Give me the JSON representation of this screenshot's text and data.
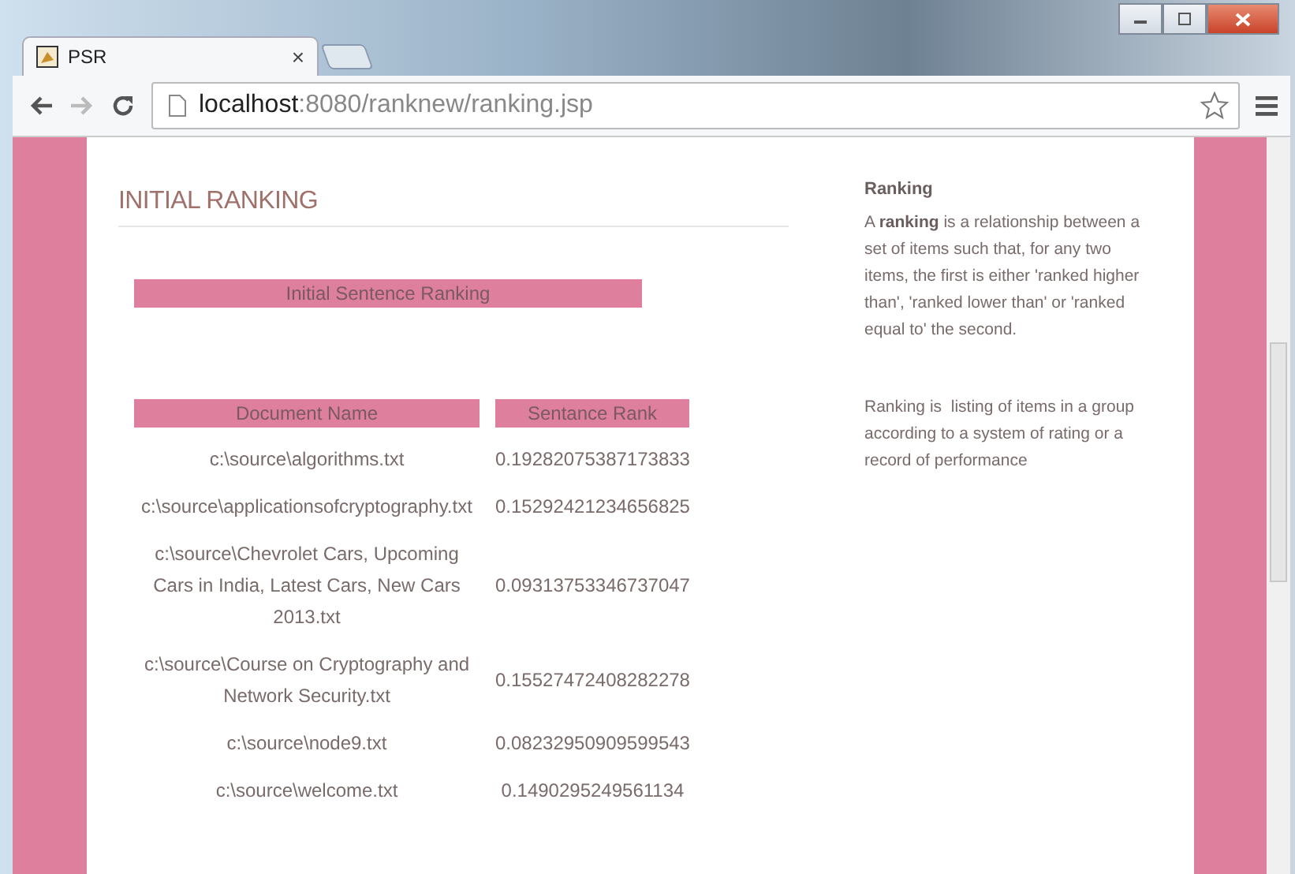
{
  "browser": {
    "tab_title": "PSR",
    "tab_close": "×",
    "url_host": "localhost",
    "url_path": ":8080/ranknew/ranking.jsp"
  },
  "page": {
    "heading": "INITIAL RANKING",
    "table_caption": "Initial Sentence Ranking",
    "columns": [
      "Document Name",
      "Sentance Rank"
    ],
    "rows": [
      {
        "document": "c:\\source\\algorithms.txt",
        "rank": "0.19282075387173833"
      },
      {
        "document": "c:\\source\\applicationsofcryptography.txt",
        "rank": "0.15292421234656825"
      },
      {
        "document": "c:\\source\\Chevrolet Cars, Upcoming Cars in India, Latest Cars, New Cars 2013.txt",
        "rank": "0.09313753346737047"
      },
      {
        "document": "c:\\source\\Course on Cryptography and Network Security.txt",
        "rank": "0.15527472408282278"
      },
      {
        "document": "c:\\source\\node9.txt",
        "rank": "0.08232950909599543"
      },
      {
        "document": "c:\\source\\welcome.txt",
        "rank": "0.1490295249561134"
      }
    ]
  },
  "sidebar": {
    "title": "Ranking",
    "paragraphs": [
      "A **ranking** is a relationship between a set of items such that, for any two items, the first is either 'ranked higher than', 'ranked lower than' or 'ranked equal to' the second.",
      "Ranking is  listing of items in a group according to a system of rating or a record of performance"
    ]
  }
}
